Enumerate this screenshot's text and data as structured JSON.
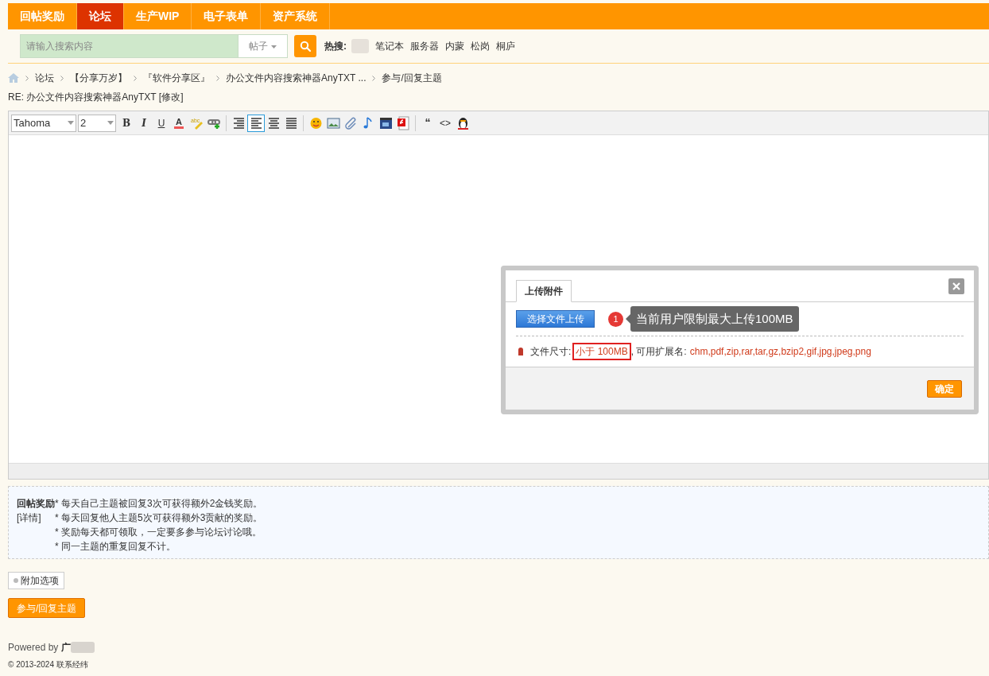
{
  "nav": [
    {
      "label": "回帖奖励",
      "selected": false
    },
    {
      "label": "论坛",
      "selected": true
    },
    {
      "label": "生产WIP",
      "selected": false
    },
    {
      "label": "电子表单",
      "selected": false
    },
    {
      "label": "资产系统",
      "selected": false
    }
  ],
  "search": {
    "placeholder": "请输入搜索内容",
    "scope": "帖子",
    "hot_label": "热搜:",
    "hot_terms": [
      "笔记本",
      "服务器",
      "内蒙",
      "松岗",
      "桐庐"
    ]
  },
  "breadcrumb": [
    "论坛",
    "【分享万岁】",
    "『软件分享区』",
    "办公文件内容搜索神器AnyTXT ...",
    "参与/回复主题"
  ],
  "post_title": "RE: 办公文件内容搜索神器AnyTXT [修改]",
  "toolbar": [
    [
      {
        "kind": "font",
        "label": "Tahoma"
      },
      {
        "kind": "size",
        "label": "2"
      },
      {
        "kind": "bold",
        "label": "B"
      },
      {
        "kind": "italic",
        "label": "I"
      },
      {
        "kind": "underline",
        "label": "U"
      },
      {
        "kind": "color",
        "label": "A"
      },
      {
        "kind": "highlight",
        "label": "abc"
      },
      {
        "kind": "link"
      }
    ],
    [
      {
        "kind": "align-right",
        "selected": false
      },
      {
        "kind": "align-left",
        "selected": true
      },
      {
        "kind": "align-center",
        "selected": false
      },
      {
        "kind": "align-justify",
        "selected": false
      }
    ],
    [
      {
        "kind": "smiley"
      },
      {
        "kind": "image"
      },
      {
        "kind": "attach"
      },
      {
        "kind": "music"
      },
      {
        "kind": "video"
      },
      {
        "kind": "flash"
      }
    ],
    [
      {
        "kind": "quote",
        "label": "“"
      },
      {
        "kind": "code",
        "label": "<>"
      },
      {
        "kind": "penguin"
      }
    ]
  ],
  "upload_dialog": {
    "tab": "上传附件",
    "choose_button": "选择文件上传",
    "step": "1",
    "tooltip": "当前用户限制最大上传100MB",
    "size_label": "文件尺寸:",
    "size_value": "小于 100MB",
    "ext_label": ", 可用扩展名:",
    "extensions": "chm,pdf,zip,rar,tar,gz,bzip2,gif,jpg,jpeg,png",
    "ok_button": "确定"
  },
  "notice": {
    "title": "回帖奖励",
    "details_link": "[详情]",
    "lines": [
      "* 每天自己主题被回复3次可获得额外2金钱奖励。",
      "* 每天回复他人主题5次可获得额外3贡献的奖励。",
      "* 奖励每天都可领取，一定要多参与论坛讨论哦。",
      "* 同一主题的重复回复不计。"
    ]
  },
  "extra_options": "附加选项",
  "submit_button": "参与/回复主题",
  "footer": {
    "powered": "Powered by",
    "brand": "广",
    "copyright": "© 2013-2024",
    "contact": "联系经纬"
  }
}
